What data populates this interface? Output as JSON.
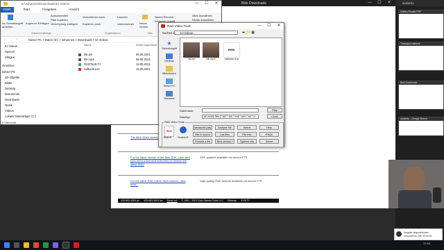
{
  "browser": {
    "title": "Bink Downloads",
    "controls": [
      "—",
      "☐",
      "✕"
    ],
    "rows": [
      {
        "link": "The Bink Video viewer... Player for x86 (x64)...",
        "desc": ""
      },
      {
        "link": "For the latest version of the Bink SDK, click here (you need a licensed customer) to receive the latest SDK!",
        "desc": "SDK updates available via secure FTP."
      },
      {
        "link": "For the latest RAD Game Tools artwork, click here...",
        "desc": "High-quality RAD artwork available via secure FTP."
      }
    ],
    "footer": [
      "425.893.4300 ph",
      "425.893.3403 fax",
      "Email us!",
      "© 1991 - 2021 Epic Games Tools LLC",
      "Sitemap",
      "SYSITY"
    ]
  },
  "explorer": {
    "title": "E:\\Johannes\\Downloads\\KI-Videos",
    "tabs": [
      "Datei",
      "Start",
      "Freigeben",
      "Ansicht"
    ],
    "ribbon": {
      "pin": "An Schnellzugriff anheften",
      "copy": "Kopieren",
      "paste": "Einfügen",
      "cut": "Ausschneiden",
      "copy_path": "Pfad kopieren",
      "paste_shortcut": "Verknüpfung einfügen",
      "move_to": "Verschieben nach",
      "copy_to": "Kopieren nach",
      "delete": "Löschen",
      "rename": "Umbenennen",
      "new_folder": "Neuer Ordner",
      "new_item": "Neues Element",
      "easy_access": "Einfacher Zugriff",
      "properties": "Eigenschaften",
      "open": "Öffnen",
      "select_all": "Alles auswählen",
      "select_none": "Nichts auswählen",
      "invert": "Auswahl umkehren",
      "groups": [
        "Zwischenablage",
        "Organisieren",
        "Neu",
        "Öffnen",
        "Auswählen"
      ]
    },
    "path": "Dieser PC  >  Daten (D:)  >  Johannes  >  Downloads  >  KI-Videos",
    "search_placeholder": "KI-Videos durchsuchen",
    "nav": [
      "KI-Videos",
      "Speech",
      "villages",
      "OneDrive",
      "Dieser PC",
      "3D-Objekte",
      "Bilder",
      "Desktop",
      "Dokumente",
      "Downloads",
      "Musik",
      "Videos",
      "Lokaler Datenträger (C:)"
    ],
    "columns": [
      "Name",
      "Änderungsdatum",
      "Typ"
    ],
    "files": [
      {
        "name": "bik.avi",
        "date": "06.06.2021"
      },
      {
        "name": "bik.mp4",
        "date": "06.06.2021"
      },
      {
        "name": "RADTools.7z",
        "date": "15.05.2021"
      },
      {
        "name": "radtools.exe",
        "date": "15.05.2021"
      }
    ],
    "status": "4 Elemente"
  },
  "rad": {
    "title": "RAD Video Tools",
    "lookin_label": "Suchen in:",
    "lookin_value": "KI-Videos",
    "places": [
      "Schnellzugriff",
      "Desktop",
      "Bibliotheken",
      "Dieser PC",
      "Netzwerk"
    ],
    "thumbs": [
      "bik.avi",
      "bik.mp4",
      "radtools.exe"
    ],
    "filename_label": "Dateiname:",
    "filetype_label": "Dateityp:",
    "filetype_value": "All media files (*.bk2,*.bik,*.smk,*.wav,*.avi,*.m",
    "play": "Play",
    "close": "Close",
    "group_title": "RAD Video Tools",
    "bink_it": "Bink it!",
    "smack_it": "Smack it!",
    "buttons": [
      [
        "Advanced play",
        "Analyze file",
        "Batch",
        "Help"
      ],
      [
        "Mix in sound",
        "List files",
        "File info",
        "FAQs"
      ],
      [
        "Convert a file",
        "New version?",
        "System info",
        "About"
      ]
    ]
  },
  "right": {
    "tab": "audacity",
    "thumbs": [
      "Galileo Reader PDF",
      "Tradepilot software",
      "Bink Downloads",
      "audacity – Google Search"
    ]
  },
  "toast": {
    "line1": "Aufgabe abgeschlossen",
    "line2": "Verstrichene Zeit: 00:00:03"
  },
  "clock": "17:44"
}
